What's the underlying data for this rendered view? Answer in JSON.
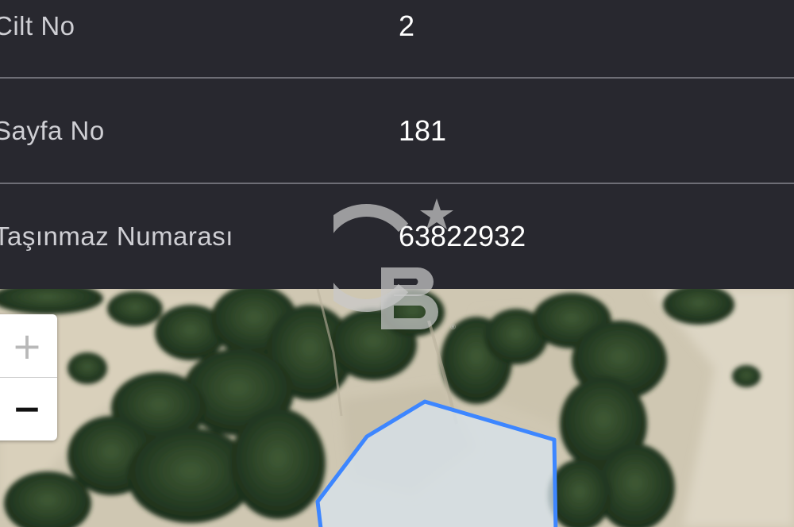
{
  "parcel_info": {
    "rows": [
      {
        "label": "Cilt No",
        "value": "2"
      },
      {
        "label": "Sayfa No",
        "value": "181"
      },
      {
        "label": "Taşınmaz Numarası",
        "value": "63822932"
      }
    ]
  },
  "map": {
    "zoom_in_label": "+",
    "zoom_out_label": "−",
    "parcel_outline_color": "#3d86ff",
    "parcel_fill_color": "#d8e4ef"
  },
  "watermark": {
    "icon": "cb-logo-icon",
    "trademark": "®"
  },
  "colors": {
    "panel_background": "#28282f",
    "divider": "#6e6e76"
  }
}
